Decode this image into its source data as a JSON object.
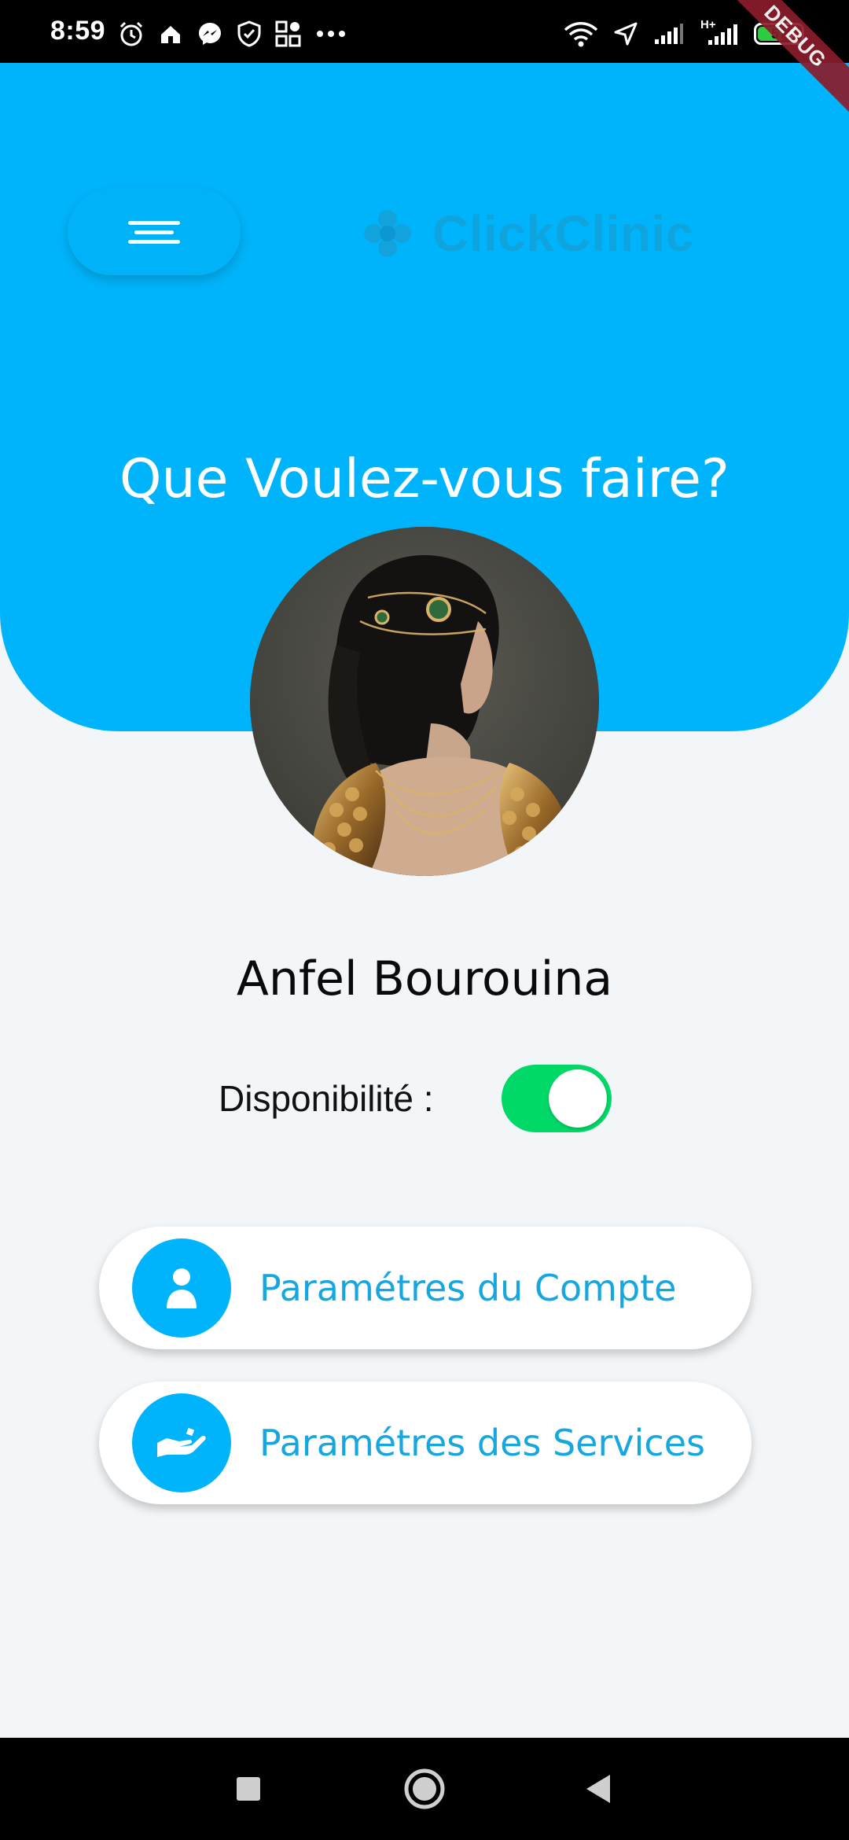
{
  "status_bar": {
    "time": "8:59",
    "battery_level": "57",
    "battery_fraction": 0.57,
    "debug_label": "DEBUG",
    "network_label": "H+",
    "left_icons": [
      "alarm-icon",
      "home-icon",
      "messenger-icon",
      "shield-icon",
      "apps-icon",
      "more-icon"
    ],
    "right_icons": [
      "wifi-icon",
      "location-icon",
      "signal-icon",
      "signal-h-plus-icon",
      "battery-icon"
    ]
  },
  "header": {
    "brand_name": "ClickClinic",
    "headline": "Que Voulez-vous faire?",
    "menu_icon": "hamburger-menu-icon",
    "color": "#00b4fb"
  },
  "profile": {
    "name": "Anfel Bourouina",
    "availability_label": "Disponibilité :",
    "availability_on": true
  },
  "actions": [
    {
      "label": "Paramétres du Compte",
      "icon": "person-icon"
    },
    {
      "label": "Paramétres des Services",
      "icon": "service-hand-icon"
    }
  ],
  "nav_bar": {
    "buttons": [
      "recent-apps-icon",
      "home-icon",
      "back-icon"
    ]
  },
  "colors": {
    "accent": "#00b4fb",
    "toggle_on": "#00d968",
    "button_text": "#17a7e0",
    "background": "#f3f6f8"
  }
}
